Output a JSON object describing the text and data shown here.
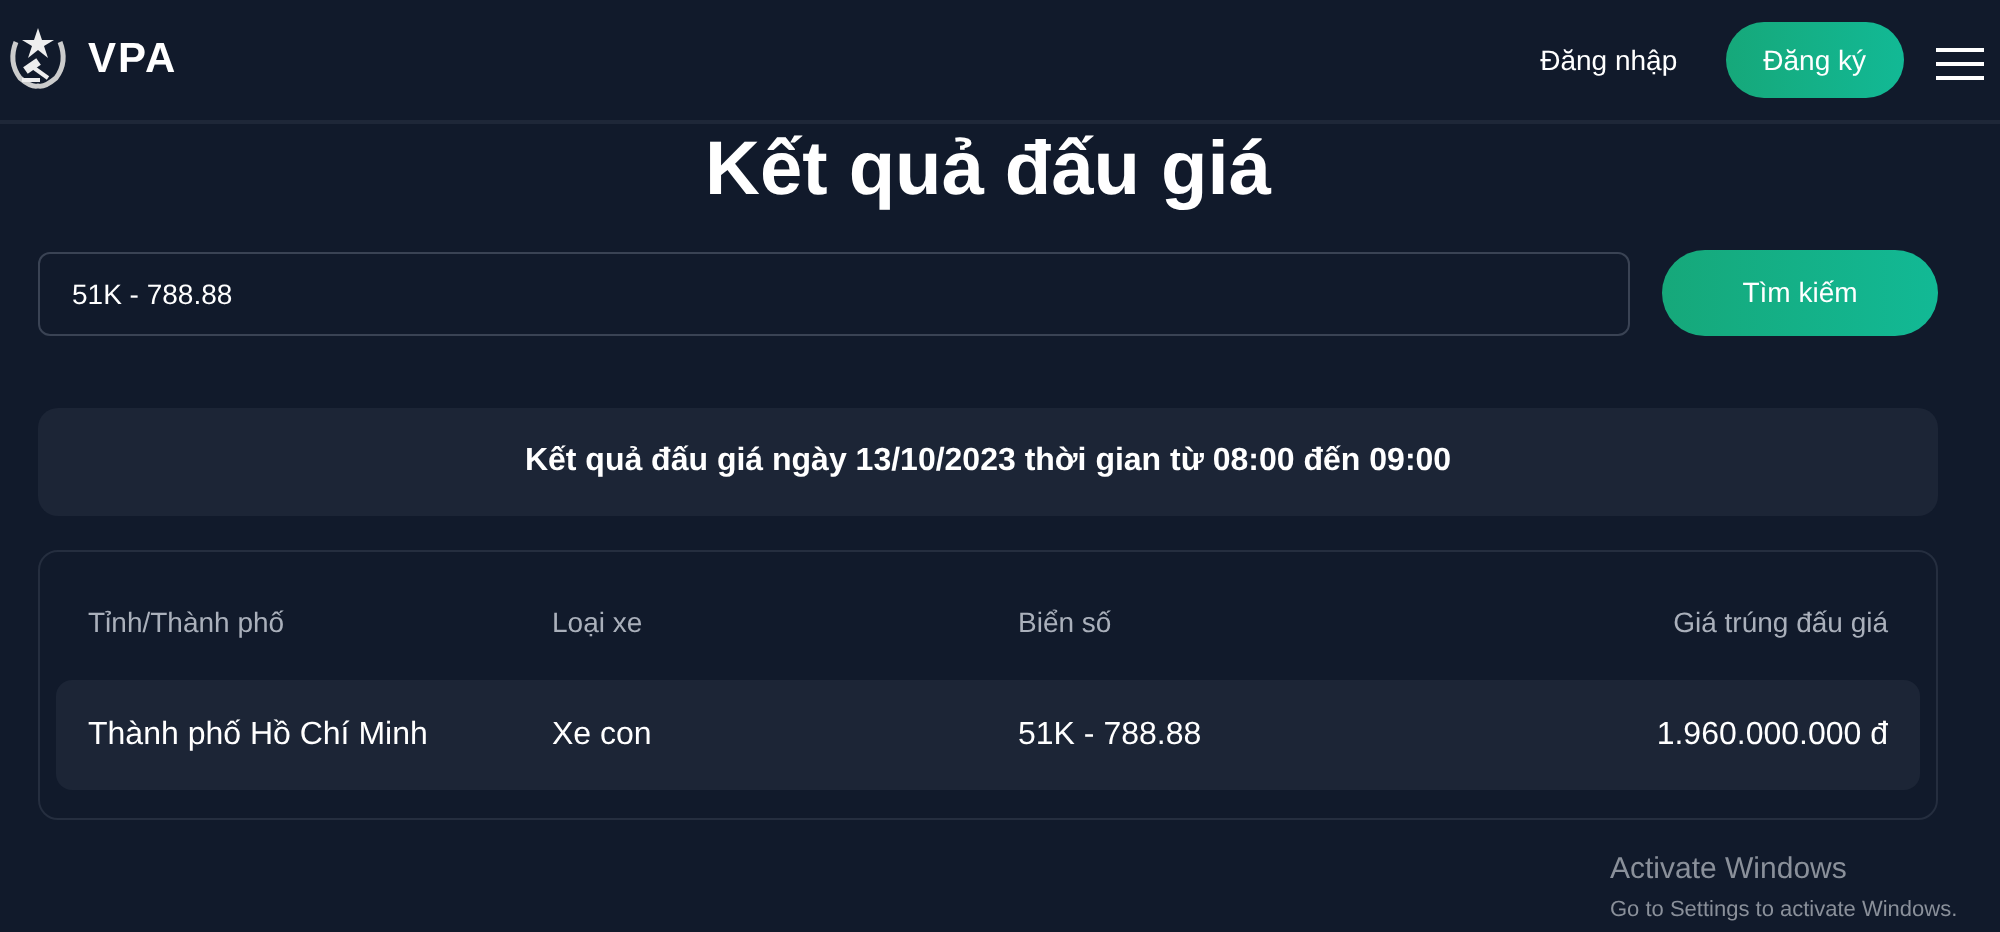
{
  "header": {
    "logo_text": "VPA",
    "login": "Đăng nhập",
    "register": "Đăng ký"
  },
  "title": "Kết quả đấu giá",
  "search": {
    "value": "51K - 788.88",
    "button": "Tìm kiếm"
  },
  "session_info": "Kết quả đấu giá ngày 13/10/2023 thời gian từ 08:00 đến 09:00",
  "table": {
    "columns": [
      "Tỉnh/Thành phố",
      "Loại xe",
      "Biển số",
      "Giá trúng đấu giá"
    ],
    "rows": [
      [
        "Thành phố Hồ Chí Minh",
        "Xe con",
        "51K - 788.88",
        "1.960.000.000 đ"
      ]
    ]
  },
  "os_notice": {
    "title": "Activate Windows",
    "message": "Go to Settings to activate Windows."
  }
}
